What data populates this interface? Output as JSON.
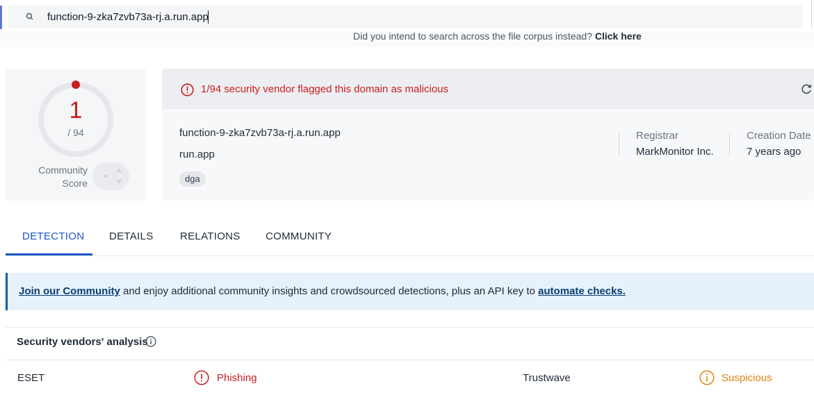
{
  "search": {
    "value": "function-9-zka7zvb73a-rj.a.run.app",
    "icon": "search-icon"
  },
  "hint": {
    "text": "Did you intend to search across the file corpus instead?",
    "link": "Click here"
  },
  "score": {
    "detections": "1",
    "total": "/ 94",
    "community_label_1": "Community",
    "community_label_2": "Score"
  },
  "alert": {
    "text": "1/94 security vendor flagged this domain as malicious"
  },
  "domain": {
    "name": "function-9-zka7zvb73a-rj.a.run.app",
    "parent": "run.app",
    "tag": "dga"
  },
  "meta": {
    "registrar_label": "Registrar",
    "registrar_value": "MarkMonitor Inc.",
    "creation_label": "Creation Date",
    "creation_value": "7 years ago"
  },
  "tabs": [
    {
      "label": "DETECTION"
    },
    {
      "label": "DETAILS"
    },
    {
      "label": "RELATIONS"
    },
    {
      "label": "COMMUNITY"
    }
  ],
  "banner": {
    "link1": "Join our Community",
    "middle": " and enjoy additional community insights and crowdsourced detections, plus an API key to ",
    "link2": "automate checks."
  },
  "vendors": {
    "heading": "Security vendors' analysis",
    "rows": [
      {
        "vendor1": "ESET",
        "result1": "Phishing",
        "vendor2": "Trustwave",
        "result2": "Suspicious"
      }
    ]
  },
  "colors": {
    "malicious": "#c81e1e",
    "suspicious": "#e0820d",
    "accent": "#1b55c4"
  }
}
